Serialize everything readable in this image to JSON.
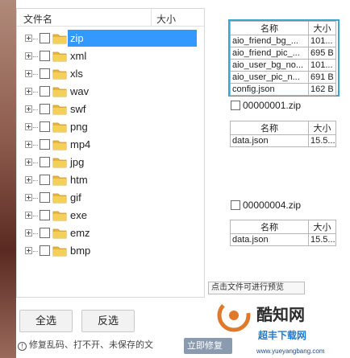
{
  "tree": {
    "header_name": "文件名",
    "header_size": "大小",
    "items": [
      {
        "label": "zip"
      },
      {
        "label": "xml"
      },
      {
        "label": "xls"
      },
      {
        "label": "wav"
      },
      {
        "label": "swf"
      },
      {
        "label": "png"
      },
      {
        "label": "mp4"
      },
      {
        "label": "jpg"
      },
      {
        "label": "htm"
      },
      {
        "label": "gif"
      },
      {
        "label": "exe"
      },
      {
        "label": "emz"
      },
      {
        "label": "bmp"
      }
    ]
  },
  "buttons": {
    "select_all": "全选",
    "invert": "反选"
  },
  "hint": "修复乱码、打不开、未保存的文",
  "bottom_pill": "立即修复",
  "preview": {
    "col_name": "名称",
    "col_size": "大小",
    "table1": [
      {
        "name": "aio_friend_bg_...",
        "size": "101..."
      },
      {
        "name": "aio_friend_pic_...",
        "size": "695 B"
      },
      {
        "name": "aio_user_bg_no...",
        "size": "101..."
      },
      {
        "name": "aio_user_pic_n...",
        "size": "691 B"
      },
      {
        "name": "config.json",
        "size": "162 B"
      }
    ],
    "zip2": "00000001.zip",
    "table2": [
      {
        "name": "data.json",
        "size": "15.5..."
      }
    ],
    "zip3": "00000004.zip",
    "table3": [
      {
        "name": "data.json",
        "size": "15.5..."
      }
    ]
  },
  "tooltip": "点击文件可进行预览",
  "watermark": {
    "brand": "酷知网",
    "sub": "超丰下载网",
    "url": "www.yueyangbang.com"
  },
  "colors": {
    "accent": "#3399ff",
    "preview_border": "#3aa7c8",
    "folder": "#e8b83a"
  }
}
